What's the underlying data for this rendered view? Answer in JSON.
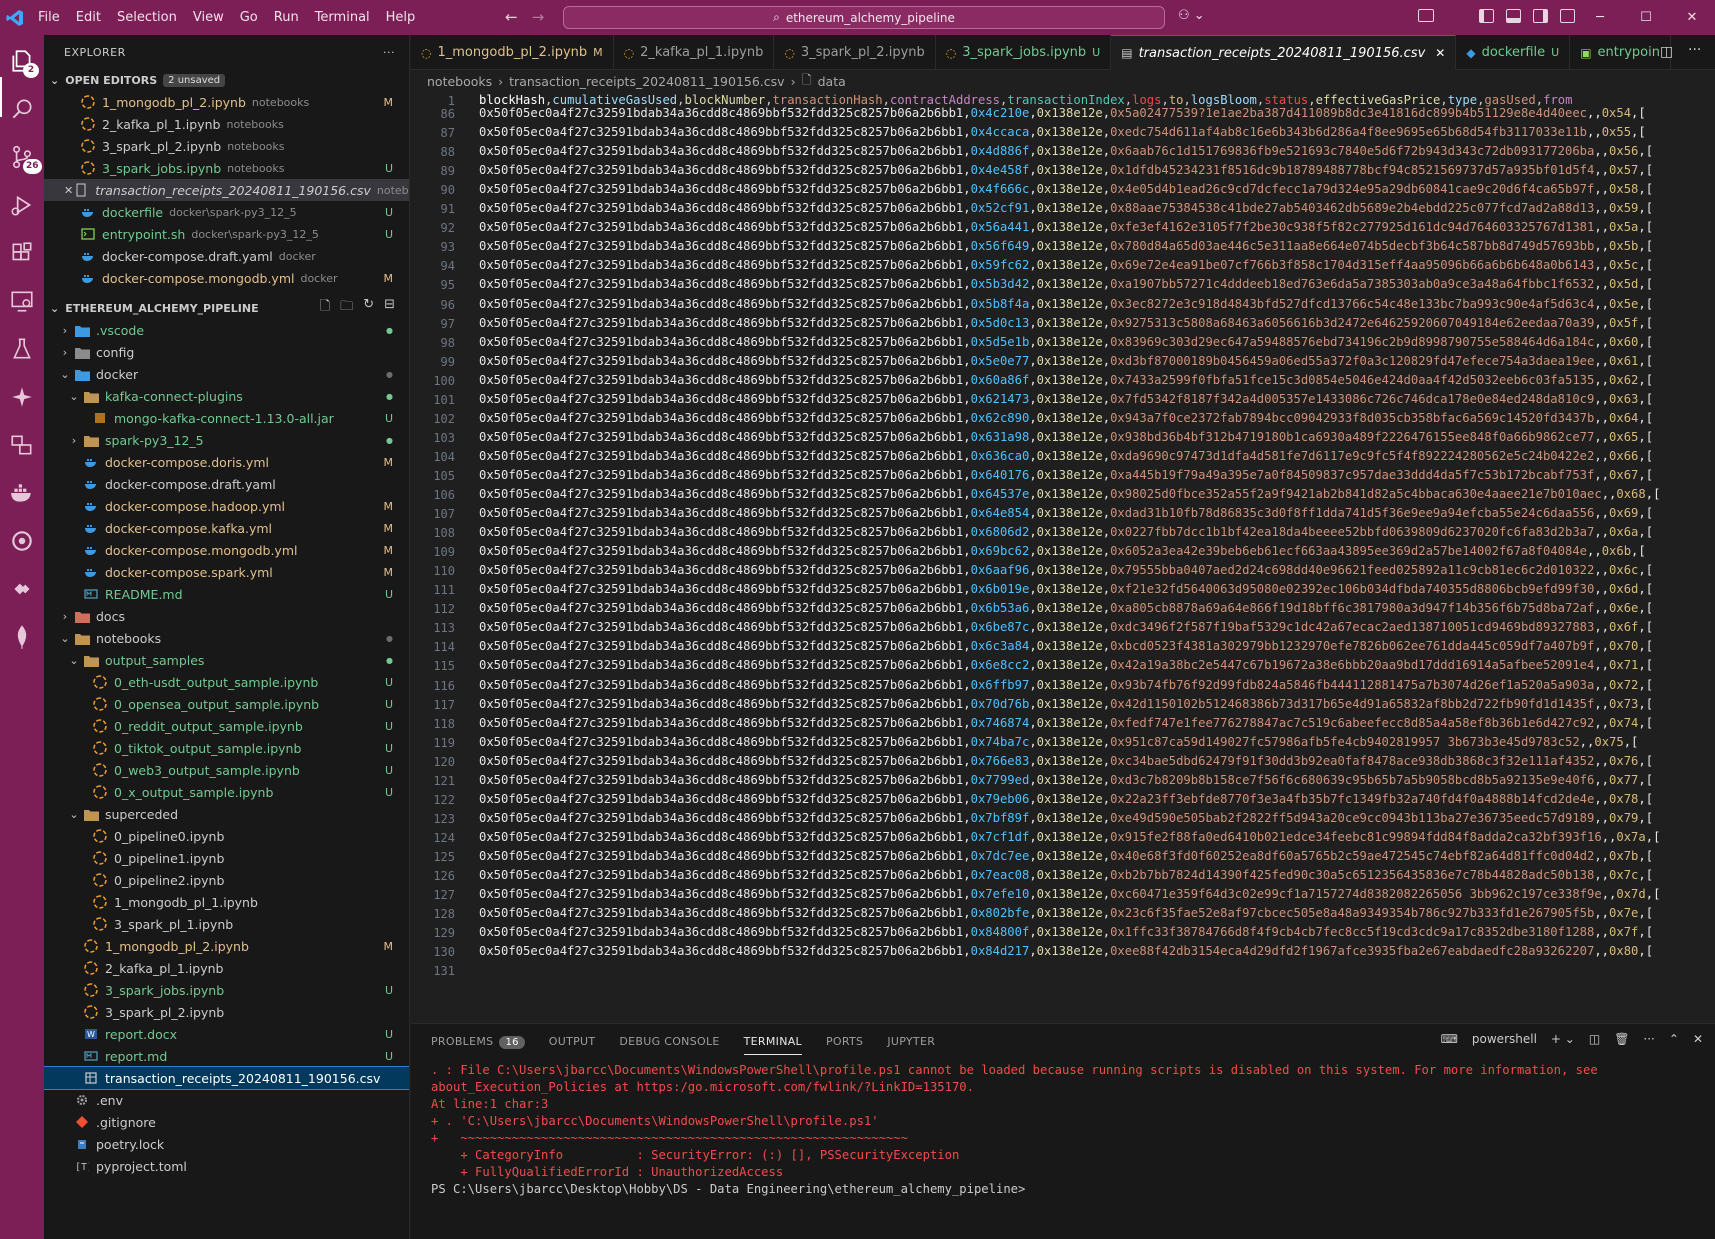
{
  "menu": [
    "File",
    "Edit",
    "Selection",
    "View",
    "Go",
    "Run",
    "Terminal",
    "Help"
  ],
  "command_center": "ethereum_alchemy_pipeline",
  "activity_badges": {
    "explorer": "2",
    "source_control": "26"
  },
  "explorer": {
    "title": "EXPLORER",
    "open_editors_label": "OPEN EDITORS",
    "unsaved_badge": "2 unsaved",
    "open_editors": [
      {
        "name": "1_mongodb_pl_2.ipynb",
        "hint": "notebooks",
        "status": "M",
        "color": "mod"
      },
      {
        "name": "2_kafka_pl_1.ipynb",
        "hint": "notebooks",
        "status": "",
        "color": "plain"
      },
      {
        "name": "3_spark_pl_2.ipynb",
        "hint": "notebooks",
        "status": "",
        "color": "plain"
      },
      {
        "name": "3_spark_jobs.ipynb",
        "hint": "notebooks",
        "status": "U",
        "color": "unt"
      },
      {
        "name": "transaction_receipts_20240811_190156.csv",
        "hint": "notebooks",
        "status": "",
        "color": "plain"
      },
      {
        "name": "dockerfile",
        "hint": "docker\\spark-py3_12_5",
        "status": "U",
        "color": "unt"
      },
      {
        "name": "entrypoint.sh",
        "hint": "docker\\spark-py3_12_5",
        "status": "U",
        "color": "unt"
      },
      {
        "name": "docker-compose.draft.yaml",
        "hint": "docker",
        "status": "",
        "color": "plain"
      },
      {
        "name": "docker-compose.mongodb.yml",
        "hint": "docker",
        "status": "M",
        "color": "mod"
      }
    ],
    "project_label": "ETHEREUM_ALCHEMY_PIPELINE",
    "tree": [
      {
        "name": ".vscode",
        "depth": 0,
        "type": "folder",
        "open": false,
        "status": "dot"
      },
      {
        "name": "config",
        "depth": 0,
        "type": "folder",
        "open": false,
        "status": ""
      },
      {
        "name": "docker",
        "depth": 0,
        "type": "folder",
        "open": true,
        "status": "dotgray"
      },
      {
        "name": "kafka-connect-plugins",
        "depth": 1,
        "type": "folder",
        "open": true,
        "status": "dot"
      },
      {
        "name": "mongo-kafka-connect-1.13.0-all.jar",
        "depth": 2,
        "type": "file",
        "status": "U"
      },
      {
        "name": "spark-py3_12_5",
        "depth": 1,
        "type": "folder",
        "open": false,
        "status": "dot"
      },
      {
        "name": "docker-compose.doris.yml",
        "depth": 1,
        "type": "docker",
        "status": "M"
      },
      {
        "name": "docker-compose.draft.yaml",
        "depth": 1,
        "type": "docker",
        "status": ""
      },
      {
        "name": "docker-compose.hadoop.yml",
        "depth": 1,
        "type": "docker",
        "status": "M"
      },
      {
        "name": "docker-compose.kafka.yml",
        "depth": 1,
        "type": "docker",
        "status": "M"
      },
      {
        "name": "docker-compose.mongodb.yml",
        "depth": 1,
        "type": "docker",
        "status": "M"
      },
      {
        "name": "docker-compose.spark.yml",
        "depth": 1,
        "type": "docker",
        "status": "M"
      },
      {
        "name": "README.md",
        "depth": 1,
        "type": "md",
        "status": "U"
      },
      {
        "name": "docs",
        "depth": 0,
        "type": "folder",
        "open": false,
        "status": ""
      },
      {
        "name": "notebooks",
        "depth": 0,
        "type": "folder",
        "open": true,
        "status": "dotgray"
      },
      {
        "name": "output_samples",
        "depth": 1,
        "type": "folder",
        "open": true,
        "status": "dot"
      },
      {
        "name": "0_eth-usdt_output_sample.ipynb",
        "depth": 2,
        "type": "nb",
        "status": "U"
      },
      {
        "name": "0_opensea_output_sample.ipynb",
        "depth": 2,
        "type": "nb",
        "status": "U"
      },
      {
        "name": "0_reddit_output_sample.ipynb",
        "depth": 2,
        "type": "nb",
        "status": "U"
      },
      {
        "name": "0_tiktok_output_sample.ipynb",
        "depth": 2,
        "type": "nb",
        "status": "U"
      },
      {
        "name": "0_web3_output_sample.ipynb",
        "depth": 2,
        "type": "nb",
        "status": "U"
      },
      {
        "name": "0_x_output_sample.ipynb",
        "depth": 2,
        "type": "nb",
        "status": "U"
      },
      {
        "name": "superceded",
        "depth": 1,
        "type": "folder",
        "open": true,
        "status": ""
      },
      {
        "name": "0_pipeline0.ipynb",
        "depth": 2,
        "type": "nb",
        "status": ""
      },
      {
        "name": "0_pipeline1.ipynb",
        "depth": 2,
        "type": "nb",
        "status": ""
      },
      {
        "name": "0_pipeline2.ipynb",
        "depth": 2,
        "type": "nb",
        "status": ""
      },
      {
        "name": "1_mongodb_pl_1.ipynb",
        "depth": 2,
        "type": "nb",
        "status": ""
      },
      {
        "name": "3_spark_pl_1.ipynb",
        "depth": 2,
        "type": "nb",
        "status": ""
      },
      {
        "name": "1_mongodb_pl_2.ipynb",
        "depth": 1,
        "type": "nb",
        "status": "M"
      },
      {
        "name": "2_kafka_pl_1.ipynb",
        "depth": 1,
        "type": "nb",
        "status": ""
      },
      {
        "name": "3_spark_jobs.ipynb",
        "depth": 1,
        "type": "nb",
        "status": "U"
      },
      {
        "name": "3_spark_pl_2.ipynb",
        "depth": 1,
        "type": "nb",
        "status": ""
      },
      {
        "name": "report.docx",
        "depth": 1,
        "type": "word",
        "status": "U"
      },
      {
        "name": "report.md",
        "depth": 1,
        "type": "md",
        "status": "U"
      },
      {
        "name": "transaction_receipts_20240811_190156.csv",
        "depth": 1,
        "type": "csv",
        "status": "",
        "selected": true
      },
      {
        "name": ".env",
        "depth": 0,
        "type": "gear",
        "status": ""
      },
      {
        "name": ".gitignore",
        "depth": 0,
        "type": "git",
        "status": ""
      },
      {
        "name": "poetry.lock",
        "depth": 0,
        "type": "lock",
        "status": ""
      },
      {
        "name": "pyproject.toml",
        "depth": 0,
        "type": "toml",
        "status": ""
      }
    ]
  },
  "tabs": [
    {
      "label": "1_mongodb_pl_2.ipynb",
      "status": "M",
      "active": false,
      "color": "mod"
    },
    {
      "label": "2_kafka_pl_1.ipynb",
      "status": "",
      "active": false,
      "color": "plain"
    },
    {
      "label": "3_spark_pl_2.ipynb",
      "status": "",
      "active": false,
      "color": "plain"
    },
    {
      "label": "3_spark_jobs.ipynb",
      "status": "U",
      "active": false,
      "color": "unt"
    },
    {
      "label": "transaction_receipts_20240811_190156.csv",
      "status": "",
      "active": true,
      "color": "plain"
    },
    {
      "label": "dockerfile",
      "status": "U",
      "active": false,
      "color": "unt"
    },
    {
      "label": "entrypoin",
      "status": "",
      "active": false,
      "color": "unt"
    }
  ],
  "breadcrumb": [
    "notebooks",
    "transaction_receipts_20240811_190156.csv",
    "data"
  ],
  "csv": {
    "header_fields": [
      "blockHash",
      "cumulativeGasUsed",
      "blockNumber",
      "transactionHash",
      "contractAddress",
      "transactionIndex",
      "logs",
      "to",
      "logsBloom",
      "status",
      "effectiveGasPrice",
      "type",
      "gasUsed",
      "from"
    ],
    "block_hash": "0x50f05ec0a4f27c32591bdab34a36cdd8c4869bbf532fdd325c8257b06a2b6bb1",
    "block_number": "0x138e12e",
    "rows": [
      {
        "ln": "86",
        "gas": "0x4c210e",
        "tx": "0x5a02477539?1e1ae2ba387d411089b8dc3e41816dc899b4b51129e8e4d40eec",
        "idx": "0x54"
      },
      {
        "ln": "87",
        "gas": "0x4ccaca",
        "tx": "0xedc754d611af4ab8c16e6b343b6d286a4f8ee9695e65b68d54fb3117033e11b",
        "idx": "0x55"
      },
      {
        "ln": "88",
        "gas": "0x4d886f",
        "tx": "0x6aab76c1d151769836fb9e521693c7840e5d6f72b943d343c72db093177206ba",
        "idx": "0x56"
      },
      {
        "ln": "89",
        "gas": "0x4e458f",
        "tx": "0x1dfdb45234231f8516dc9b18789488778bcf94c8521569737d57a935bf01d5f4",
        "idx": "0x57"
      },
      {
        "ln": "90",
        "gas": "0x4f666c",
        "tx": "0x4e05d4b1ead26c9cd7dcfecc1a79d324e95a29db60841cae9c20d6f4ca65b97f",
        "idx": "0x58"
      },
      {
        "ln": "91",
        "gas": "0x52cf91",
        "tx": "0x88aae75384538c41bde27ab5403462db5689e2b4ebdd225c077fcd7ad2a88d13",
        "idx": "0x59"
      },
      {
        "ln": "92",
        "gas": "0x56a441",
        "tx": "0xfe3ef4162e3105f7f2be30c938f5f82c277925d161dc94d764603325767d1381",
        "idx": "0x5a"
      },
      {
        "ln": "93",
        "gas": "0x56f649",
        "tx": "0x780d84a65d03ae446c5e311aa8e664e074b5decbf3b64c587bb8d749d57693bb",
        "idx": "0x5b"
      },
      {
        "ln": "94",
        "gas": "0x59fc62",
        "tx": "0x69e72e4ea91be07cf766b3f858c1704d315eff4aa95096b66a6b6b648a0b6143",
        "idx": "0x5c"
      },
      {
        "ln": "95",
        "gas": "0x5b3d42",
        "tx": "0xa1907bb57271c4dddeeb18ed763e6da5a7385303ab0a9ce3a48a64fbbc1f6532",
        "idx": "0x5d"
      },
      {
        "ln": "96",
        "gas": "0x5b8f4a",
        "tx": "0x3ec8272e3c918d4843bfd527dfcd13766c54c48e133bc7ba993c90e4af5d63c4",
        "idx": "0x5e"
      },
      {
        "ln": "97",
        "gas": "0x5d0c13",
        "tx": "0x9275313c5808a68463a6056616b3d2472e64625920607049184e62eedaa70a39",
        "idx": "0x5f"
      },
      {
        "ln": "98",
        "gas": "0x5d5e1b",
        "tx": "0x83969c303d29ec647a59488576ebd734196c2b9d8998790755e588464d6a184c",
        "idx": "0x60"
      },
      {
        "ln": "99",
        "gas": "0x5e0e77",
        "tx": "0xd3bf87000189b0456459a06ed55a372f0a3c120829fd47efece754a3daea19ee",
        "idx": "0x61"
      },
      {
        "ln": "100",
        "gas": "0x60a86f",
        "tx": "0x7433a2599f0fbfa51fce15c3d0854e5046e424d0aa4f42d5032eeb6c03fa5135",
        "idx": "0x62"
      },
      {
        "ln": "101",
        "gas": "0x621473",
        "tx": "0x7fd5342f8187f342a4d005357e1433086c726c746dca178e0e84ed248da810c9",
        "idx": "0x63"
      },
      {
        "ln": "102",
        "gas": "0x62c890",
        "tx": "0x943a7f0ce2372fab7894bcc09042933f8d035cb358bfac6a569c14520fd3437b",
        "idx": "0x64"
      },
      {
        "ln": "103",
        "gas": "0x631a98",
        "tx": "0x938bd36b4bf312b4719180b1ca6930a489f2226476155ee848f0a66b9862ce77",
        "idx": "0x65"
      },
      {
        "ln": "104",
        "gas": "0x636ca0",
        "tx": "0xda9690c97473d1dfa4d581fe7d6117e9c9fc5f4f892224280562e5c24b0422e2",
        "idx": "0x66"
      },
      {
        "ln": "105",
        "gas": "0x640176",
        "tx": "0xa445b19f79a49a395e7a0f84509837c957dae33ddd4da5f7c53b172bcabf753f",
        "idx": "0x67"
      },
      {
        "ln": "106",
        "gas": "0x64537e",
        "tx": "0x98025d0fbce352a55f2a9f9421ab2b841d82a5c4bbaca630e4aaee21e7b010aec",
        "idx": "0x68"
      },
      {
        "ln": "107",
        "gas": "0x64e854",
        "tx": "0xdad31b10fb78d86835c3d0f8ff1dda741d5f36e9ee9a94efcba55e24c6daa556",
        "idx": "0x69"
      },
      {
        "ln": "108",
        "gas": "0x6806d2",
        "tx": "0x0227fbb7dcc1b1bf42ea18da4beeee52bbfd0639809d6237020fc6fa83d2b3a7",
        "idx": "0x6a"
      },
      {
        "ln": "109",
        "gas": "0x69bc62",
        "tx": "0x6052a3ea42e39beb6eb61ecf663aa43895ee369d2a57be14002f67a8f04084e",
        "idx": "0x6b"
      },
      {
        "ln": "110",
        "gas": "0x6aaf96",
        "tx": "0x79555bba0407aed2d24c698dd40e96621feed025892a11c9cb81ec6c2d010322",
        "idx": "0x6c"
      },
      {
        "ln": "111",
        "gas": "0x6b019e",
        "tx": "0xf21e32fd5640063d95080e02392ec106b034dfbda740355d8806bcb9efd99f30",
        "idx": "0x6d"
      },
      {
        "ln": "112",
        "gas": "0x6b53a6",
        "tx": "0xa805cb8878a69a64e866f19d18bff6c3817980a3d947f14b356f6b75d8ba72af",
        "idx": "0x6e"
      },
      {
        "ln": "113",
        "gas": "0x6be87c",
        "tx": "0xdc3496f2f587f19baf5329c1dc42a67ecac2aed138710051cd9469bd89327883",
        "idx": "0x6f"
      },
      {
        "ln": "114",
        "gas": "0x6c3a84",
        "tx": "0xbcd0523f4381a302979bb1232970efe7826b062ee761dda445c059df7a407b9f",
        "idx": "0x70"
      },
      {
        "ln": "115",
        "gas": "0x6e8cc2",
        "tx": "0x42a19a38bc2e5447c67b19672a38e6bbb20aa9bd17ddd16914a5afbee52091e4",
        "idx": "0x71"
      },
      {
        "ln": "116",
        "gas": "0x6ffb97",
        "tx": "0x93b74fb76f92d99fdb824a5846fb444112881475a7b3074d26ef1a520a5a903a",
        "idx": "0x72"
      },
      {
        "ln": "117",
        "gas": "0x70d76b",
        "tx": "0x42d1150102b512468386b73d317b65e4d91a65832af8bb2d722fb90fd1d1435f",
        "idx": "0x73"
      },
      {
        "ln": "118",
        "gas": "0x746874",
        "tx": "0xfedf747e1fee776278847ac7c519c6abeefecc8d85a4a58ef8b36b1e6d427c92",
        "idx": "0x74"
      },
      {
        "ln": "119",
        "gas": "0x74ba7c",
        "tx": "0x951c87ca59d149027fc57986afb5fe4cb9402819957 3b673b3e45d9783c52",
        "idx": "0x75"
      },
      {
        "ln": "120",
        "gas": "0x766e83",
        "tx": "0xc34bae5dbd62479f91f30dd3b92ea0faf8478ace938db3868c3f32e111af4352",
        "idx": "0x76"
      },
      {
        "ln": "121",
        "gas": "0x7799ed",
        "tx": "0xd3c7b8209b8b158ce7f56f6c680639c95b65b7a5b9058bcd8b5a92135e9e40f6",
        "idx": "0x77"
      },
      {
        "ln": "122",
        "gas": "0x79eb06",
        "tx": "0x22a23ff3ebfde8770f3e3a4fb35b7fc1349fb32a740fd4f0a4888b14fcd2de4e",
        "idx": "0x78"
      },
      {
        "ln": "123",
        "gas": "0x7bf89f",
        "tx": "0xe49d590e505bab2f2822ff5d943a20ce9cc0943b113ba27e36735eedc57d9189",
        "idx": "0x79"
      },
      {
        "ln": "124",
        "gas": "0x7cf1df",
        "tx": "0x915fe2f88fa0ed6410b021edce34feebc81c99894fdd84f8adda2ca32bf393f16",
        "idx": "0x7a"
      },
      {
        "ln": "125",
        "gas": "0x7dc7ee",
        "tx": "0x40e68f3fd0f60252ea8df60a5765b2c59ae472545c74ebf82a64d81ffc0d04d2",
        "idx": "0x7b"
      },
      {
        "ln": "126",
        "gas": "0x7eac08",
        "tx": "0xb2b7bb7824d14390f425fed90c30a5c6512356435836e7c78b44828adc50b138",
        "idx": "0x7c"
      },
      {
        "ln": "127",
        "gas": "0x7efe10",
        "tx": "0xc60471e359f64d3c02e99cf1a7157274d8382082265056 3bb962c197ce338f9e",
        "idx": "0x7d"
      },
      {
        "ln": "128",
        "gas": "0x802bfe",
        "tx": "0x23c6f35fae52e8af97cbcec505e8a48a9349354b786c927b333fd1e267905f5b",
        "idx": "0x7e"
      },
      {
        "ln": "129",
        "gas": "0x84800f",
        "tx": "0x1ffc33f38784766d8f4f9cb4cb7fec8cc5f19cd3cdc9a17c8352dbe3180f1288",
        "idx": "0x7f"
      },
      {
        "ln": "130",
        "gas": "0x84d217",
        "tx": "0xee88f42db3154eca4d29dfd2f1967afce3935fba2e67eabdaedfc28a93262207",
        "idx": "0x80"
      }
    ],
    "last_line": "131"
  },
  "panel": {
    "tabs": [
      "PROBLEMS",
      "OUTPUT",
      "DEBUG CONSOLE",
      "TERMINAL",
      "PORTS",
      "JUPYTER"
    ],
    "active_tab": "TERMINAL",
    "problems_count": "16",
    "shell": "powershell",
    "terminal_lines": [
      ". : File C:\\Users\\jbarcc\\Documents\\WindowsPowerShell\\profile.ps1 cannot be loaded because running scripts is disabled on this system. For more information, see",
      "about_Execution_Policies at https:/go.microsoft.com/fwlink/?LinkID=135170.",
      "At line:1 char:3",
      "+ . 'C:\\Users\\jbarcc\\Documents\\WindowsPowerShell\\profile.ps1'",
      "+   ~~~~~~~~~~~~~~~~~~~~~~~~~~~~~~~~~~~~~~~~~~~~~~~~~~~~~~~~~~~~~",
      "    + CategoryInfo          : SecurityError: (:) [], PSSecurityException",
      "    + FullyQualifiedErrorId : UnauthorizedAccess"
    ],
    "prompt": "PS C:\\Users\\jbarcc\\Desktop\\Hobby\\DS - Data Engineering\\ethereum_alchemy_pipeline>"
  }
}
